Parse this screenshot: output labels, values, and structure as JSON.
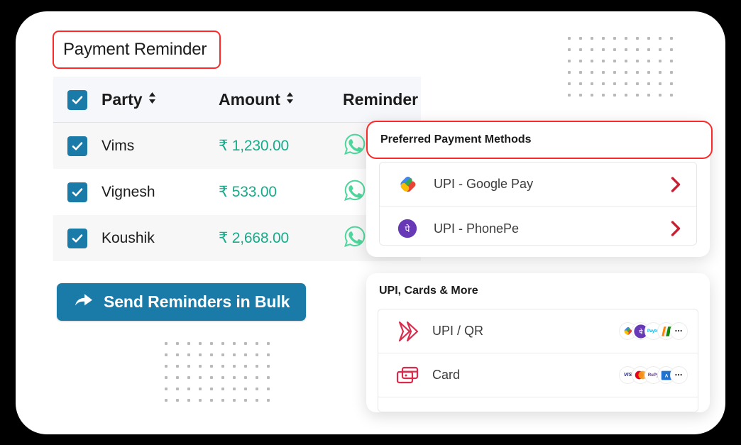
{
  "section": {
    "title": "Payment Reminder",
    "title_border_color": "#fb2a2a"
  },
  "table": {
    "columns": [
      {
        "key": "select",
        "label": ""
      },
      {
        "key": "party",
        "label": "Party",
        "sortable": true,
        "sort_icon": "sort-arrows-icon"
      },
      {
        "key": "amount",
        "label": "Amount",
        "sortable": true,
        "sort_icon": "sort-arrows-icon"
      },
      {
        "key": "reminder",
        "label": "Reminder",
        "sortable": false
      }
    ],
    "header_select_all_checked": true,
    "rows": [
      {
        "checked": true,
        "party": "Vims",
        "amount": "₹ 1,230.00",
        "reminder_icon": "whatsapp-icon"
      },
      {
        "checked": true,
        "party": "Vignesh",
        "amount": "₹ 533.00",
        "reminder_icon": "whatsapp-icon"
      },
      {
        "checked": true,
        "party": "Koushik",
        "amount": "₹ 2,668.00",
        "reminder_icon": "whatsapp-icon"
      }
    ],
    "amount_color": "#17ab8c",
    "checkbox_color": "#1a7ba8"
  },
  "send_button": {
    "label": "Send Reminders in Bulk",
    "icon": "share-arrow-icon",
    "bg_color": "#1a7ba8",
    "text_color": "#ffffff"
  },
  "preferred_panel": {
    "title": "Preferred Payment Methods",
    "highlight_color": "#fb2a2a",
    "methods": [
      {
        "label": "UPI - Google Pay",
        "icon": "google-pay-icon",
        "chevron": "chevron-right-icon"
      },
      {
        "label": "UPI - PhonePe",
        "icon": "phonepe-icon",
        "chevron": "chevron-right-icon"
      }
    ]
  },
  "more_panel": {
    "title": "UPI, Cards & More",
    "methods": [
      {
        "label": "UPI / QR",
        "icon": "upi-qr-icon",
        "badges": [
          "google-pay-badge",
          "phonepe-badge",
          "paytm-badge",
          "bhim-badge",
          "more-badge"
        ]
      },
      {
        "label": "Card",
        "icon": "card-icon",
        "badges": [
          "visa-badge",
          "mastercard-badge",
          "rupay-badge",
          "amex-badge",
          "more-badge"
        ]
      }
    ]
  },
  "decor": {
    "dot_grid_color": "#b9b9bd",
    "dot_grid_cols": 10,
    "dot_grid_rows": 6
  }
}
